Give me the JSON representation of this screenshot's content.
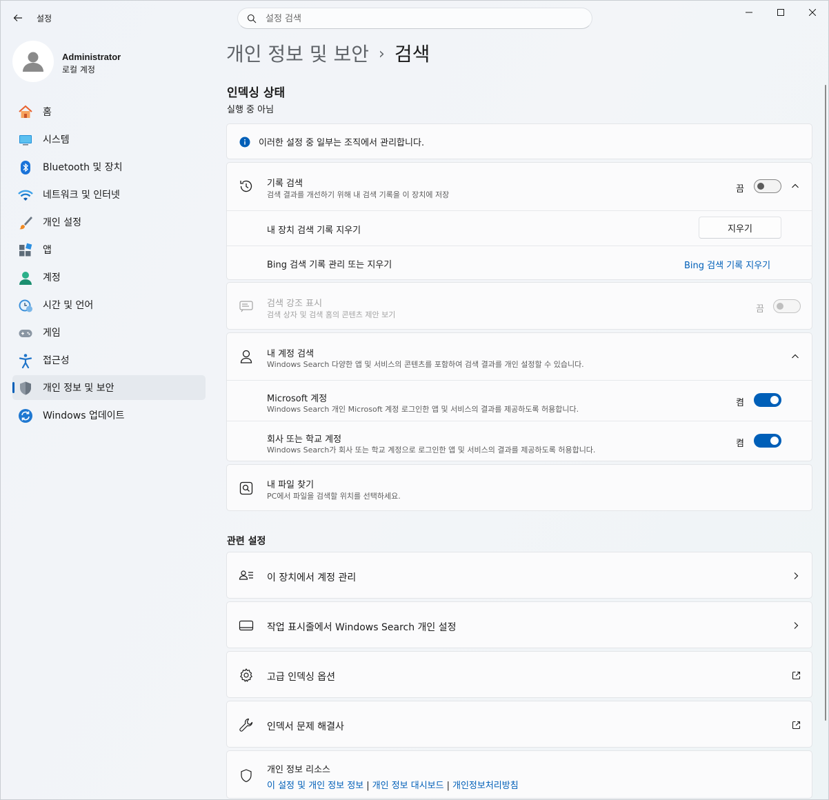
{
  "window": {
    "app_title": "설정",
    "search_placeholder": "설정 검색"
  },
  "profile": {
    "name": "Administrator",
    "account_type": "로컬 계정"
  },
  "nav": [
    {
      "label": "홈",
      "icon": "home-icon"
    },
    {
      "label": "시스템",
      "icon": "system-icon"
    },
    {
      "label": "Bluetooth 및 장치",
      "icon": "bluetooth-icon"
    },
    {
      "label": "네트워크 및 인터넷",
      "icon": "wifi-icon"
    },
    {
      "label": "개인 설정",
      "icon": "brush-icon"
    },
    {
      "label": "앱",
      "icon": "apps-icon"
    },
    {
      "label": "계정",
      "icon": "account-icon"
    },
    {
      "label": "시간 및 언어",
      "icon": "time-language-icon"
    },
    {
      "label": "게임",
      "icon": "gaming-icon"
    },
    {
      "label": "접근성",
      "icon": "accessibility-icon"
    },
    {
      "label": "개인 정보 및 보안",
      "icon": "shield-icon",
      "active": true
    },
    {
      "label": "Windows 업데이트",
      "icon": "update-icon"
    }
  ],
  "breadcrumb": {
    "parent": "개인 정보 및 보안",
    "separator": "›",
    "current": "검색"
  },
  "indexing": {
    "heading": "인덱싱 상태",
    "status": "실행 중 아님"
  },
  "managed_notice": "이러한 설정 중 일부는 조직에서 관리합니다.",
  "history_search": {
    "title": "기록 검색",
    "desc": "검색 결과를 개선하기 위해 내 검색 기록을 이 장치에 저장",
    "state_label": "끔",
    "toggle_on": false,
    "clear_device": {
      "label": "내 장치 검색 기록 지우기",
      "button": "지우기"
    },
    "bing": {
      "label": "Bing 검색 기록 관리 또는 지우기",
      "link": "Bing 검색 기록 지우기"
    }
  },
  "search_highlights": {
    "title": "검색 강조 표시",
    "desc": "검색 상자 및 검색 홈의 콘텐츠 제안 보기",
    "state_label": "끔",
    "disabled": true
  },
  "account_search": {
    "title": "내 계정 검색",
    "desc": "Windows Search 다양한 앱 및 서비스의 콘텐츠를 포함하여 검색 결과를 개인 설정할 수 있습니다.",
    "items": [
      {
        "title": "Microsoft 계정",
        "desc": "Windows Search 개인 Microsoft 계정 로그인한 앱 및 서비스의 결과를 제공하도록 허용합니다.",
        "state_label": "켬",
        "on": true
      },
      {
        "title": "회사 또는 학교 계정",
        "desc": "Windows Search가 회사 또는 학교 계정으로 로그인한 앱 및 서비스의 결과를 제공하도록 허용합니다.",
        "state_label": "켬",
        "on": true
      }
    ]
  },
  "find_files": {
    "title": "내 파일 찾기",
    "desc": "PC에서 파일을 검색할 위치를 선택하세요."
  },
  "related": {
    "heading": "관련 설정",
    "items": [
      {
        "label": "이 장치에서 계정 관리",
        "icon": "people-list-icon",
        "action": "chevron"
      },
      {
        "label": "작업 표시줄에서 Windows Search 개인 설정",
        "icon": "taskbar-icon",
        "action": "chevron"
      },
      {
        "label": "고급 인덱싱 옵션",
        "icon": "gear-icon",
        "action": "external"
      },
      {
        "label": "인덱서 문제 해결사",
        "icon": "wrench-icon",
        "action": "external"
      }
    ]
  },
  "privacy_resources": {
    "title": "개인 정보 리소스",
    "links": [
      "이 설정 및 개인 정보 정보",
      "개인 정보 대시보드",
      "개인정보처리방침"
    ]
  },
  "colors": {
    "accent": "#005fb8"
  }
}
